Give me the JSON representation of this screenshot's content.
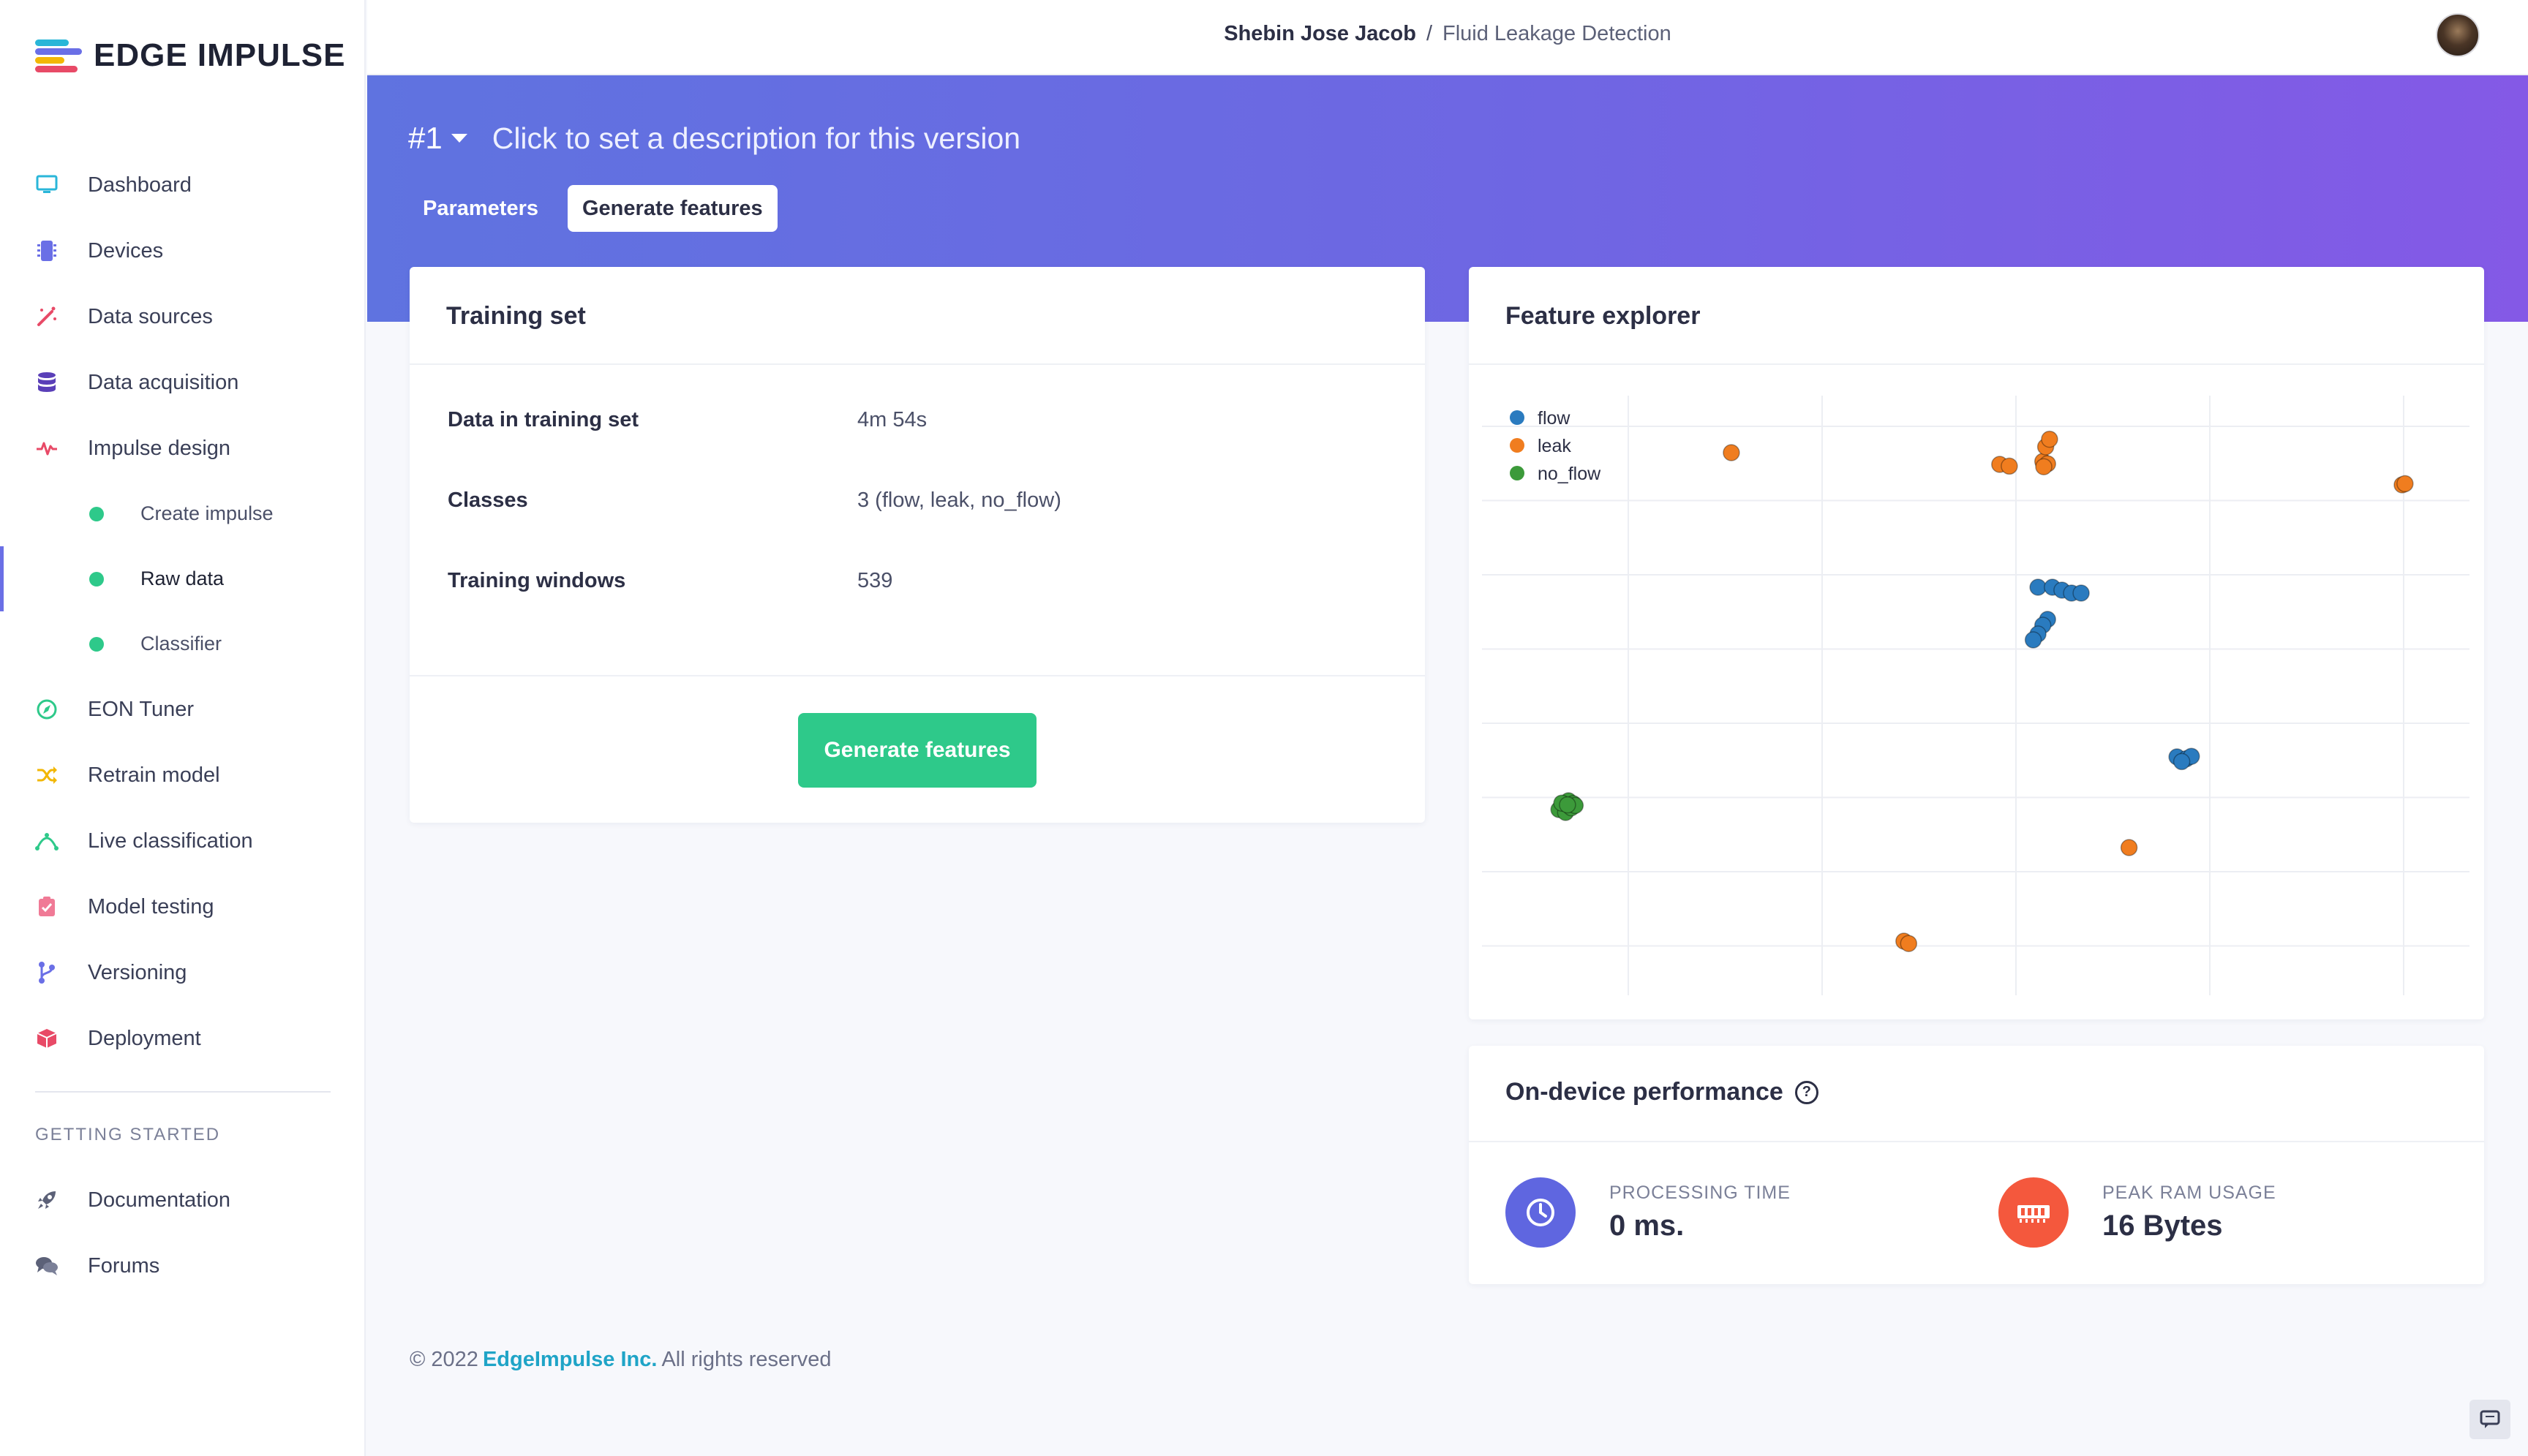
{
  "app": {
    "logo_text": "EDGE IMPULSE"
  },
  "header": {
    "owner": "Shebin Jose Jacob",
    "separator": "/",
    "project": "Fluid Leakage Detection"
  },
  "sidebar": {
    "items": [
      {
        "label": "Dashboard",
        "icon": "monitor-icon",
        "color": "#2ab6d9"
      },
      {
        "label": "Devices",
        "icon": "chip-icon",
        "color": "#6a6fe6"
      },
      {
        "label": "Data sources",
        "icon": "magic-wand-icon",
        "color": "#e84a67"
      },
      {
        "label": "Data acquisition",
        "icon": "database-icon",
        "color": "#5a3fb8"
      },
      {
        "label": "Impulse design",
        "icon": "pulse-icon",
        "color": "#e84a67"
      }
    ],
    "subitems": [
      {
        "label": "Create impulse"
      },
      {
        "label": "Raw data",
        "active": true
      },
      {
        "label": "Classifier"
      }
    ],
    "items2": [
      {
        "label": "EON Tuner",
        "icon": "compass-icon",
        "color": "#2ec98a"
      },
      {
        "label": "Retrain model",
        "icon": "shuffle-icon",
        "color": "#f2b705"
      },
      {
        "label": "Live classification",
        "icon": "curve-icon",
        "color": "#2ec98a"
      },
      {
        "label": "Model testing",
        "icon": "clipboard-check-icon",
        "color": "#f07a96"
      },
      {
        "label": "Versioning",
        "icon": "git-branch-icon",
        "color": "#6a6fe6"
      },
      {
        "label": "Deployment",
        "icon": "box-icon",
        "color": "#e84a67"
      }
    ],
    "section_title": "GETTING STARTED",
    "getting_started": [
      {
        "label": "Documentation",
        "icon": "rocket-icon"
      },
      {
        "label": "Forums",
        "icon": "chat-bubbles-icon"
      }
    ]
  },
  "banner": {
    "version": "#1",
    "description": "Click to set a description for this version",
    "tabs": [
      {
        "label": "Parameters",
        "active": false
      },
      {
        "label": "Generate features",
        "active": true
      }
    ]
  },
  "training_set": {
    "title": "Training set",
    "rows": [
      {
        "label": "Data in training set",
        "value": "4m 54s"
      },
      {
        "label": "Classes",
        "value": "3 (flow, leak, no_flow)"
      },
      {
        "label": "Training windows",
        "value": "539"
      }
    ],
    "button_label": "Generate features"
  },
  "feature_explorer": {
    "title": "Feature explorer"
  },
  "chart_data": {
    "type": "scatter",
    "legend_position": "top-left",
    "grid": true,
    "axis_ticks_shown": false,
    "x_range": [
      0,
      100
    ],
    "y_range": [
      0,
      100
    ],
    "series": [
      {
        "name": "flow",
        "color": "#2a7bbf",
        "points": [
          [
            56.5,
            68.5
          ],
          [
            58,
            68.5
          ],
          [
            59,
            68
          ],
          [
            60,
            67.5
          ],
          [
            61,
            67.5
          ],
          [
            57.5,
            63
          ],
          [
            57,
            62
          ],
          [
            56.5,
            60.5
          ],
          [
            56,
            59.5
          ],
          [
            71,
            39.5
          ],
          [
            72,
            39.2
          ],
          [
            72.5,
            39.6
          ],
          [
            71.5,
            38.7
          ]
        ]
      },
      {
        "name": "leak",
        "color": "#f07d1f",
        "points": [
          [
            24.5,
            91.5
          ],
          [
            52.5,
            89.5
          ],
          [
            53.5,
            89.2
          ],
          [
            57,
            90
          ],
          [
            57.5,
            89.6
          ],
          [
            57.3,
            92.5
          ],
          [
            57.7,
            93.8
          ],
          [
            57.1,
            89.1
          ],
          [
            94.5,
            86
          ],
          [
            94.8,
            86.2
          ],
          [
            66,
            24
          ],
          [
            42.5,
            8
          ],
          [
            43,
            7.6
          ]
        ]
      },
      {
        "name": "no_flow",
        "color": "#3c9a3a",
        "points": [
          [
            7,
            31
          ],
          [
            7.5,
            32
          ],
          [
            8,
            31.5
          ],
          [
            6.5,
            30.5
          ],
          [
            7.2,
            30
          ],
          [
            7.8,
            30.8
          ],
          [
            8.2,
            31.2
          ],
          [
            6.8,
            31.6
          ],
          [
            7.4,
            31.3
          ]
        ]
      }
    ]
  },
  "performance": {
    "title": "On-device performance",
    "metrics": [
      {
        "label": "PROCESSING TIME",
        "value": "0 ms.",
        "icon": "clock-icon",
        "color": "#5f66e0"
      },
      {
        "label": "PEAK RAM USAGE",
        "value": "16 Bytes",
        "icon": "memory-icon",
        "color": "#f4583d"
      }
    ]
  },
  "footer": {
    "copyright": "© 2022",
    "company": "EdgeImpulse Inc.",
    "suffix": "All rights reserved"
  }
}
